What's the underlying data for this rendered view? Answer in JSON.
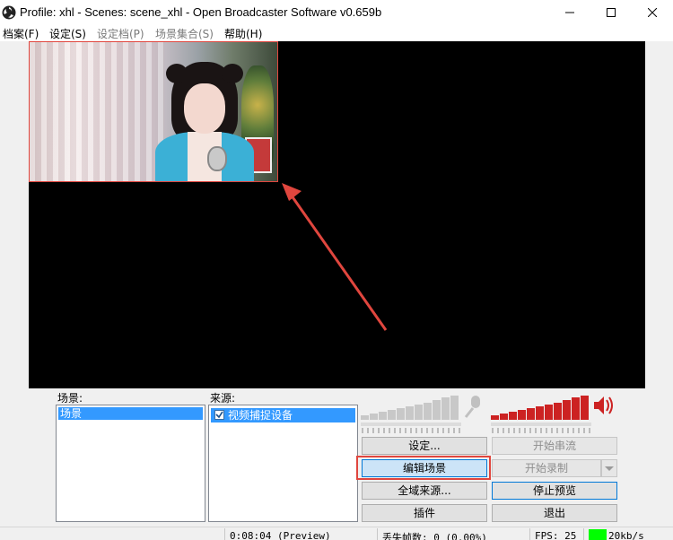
{
  "window": {
    "title": "Profile: xhl - Scenes: scene_xhl - Open Broadcaster Software v0.659b",
    "icon": "obs-logo-icon"
  },
  "menu": {
    "items": [
      "档案(F)",
      "设定(S)",
      "设定档(P)",
      "场景集合(S)",
      "帮助(H)"
    ]
  },
  "scenes": {
    "label": "场景:",
    "items": [
      "场景"
    ]
  },
  "sources": {
    "label": "来源:",
    "items": [
      {
        "label": "视频捕捉设备",
        "checked": true
      }
    ]
  },
  "audio": {
    "mic_icon": "microphone-icon",
    "speaker_icon": "speaker-icon",
    "mic_color": "#c8c8c8",
    "desktop_color": "#cc2222"
  },
  "buttons": {
    "settings": "设定...",
    "start_stream": "开始串流",
    "edit_scene": "编辑场景",
    "start_record": "开始录制",
    "global_sources": "全域来源...",
    "stop_preview": "停止预览",
    "plugins": "插件",
    "exit": "退出"
  },
  "status": {
    "time": "0:08:04 (Preview)",
    "dropped": "丢失帧数: 0 (0.00%)",
    "fps": "FPS: 25",
    "bitrate": "20kb/s",
    "bitrate_color": "#00ff00"
  },
  "colors": {
    "highlight": "#e0463e",
    "selection": "#3399ff"
  }
}
